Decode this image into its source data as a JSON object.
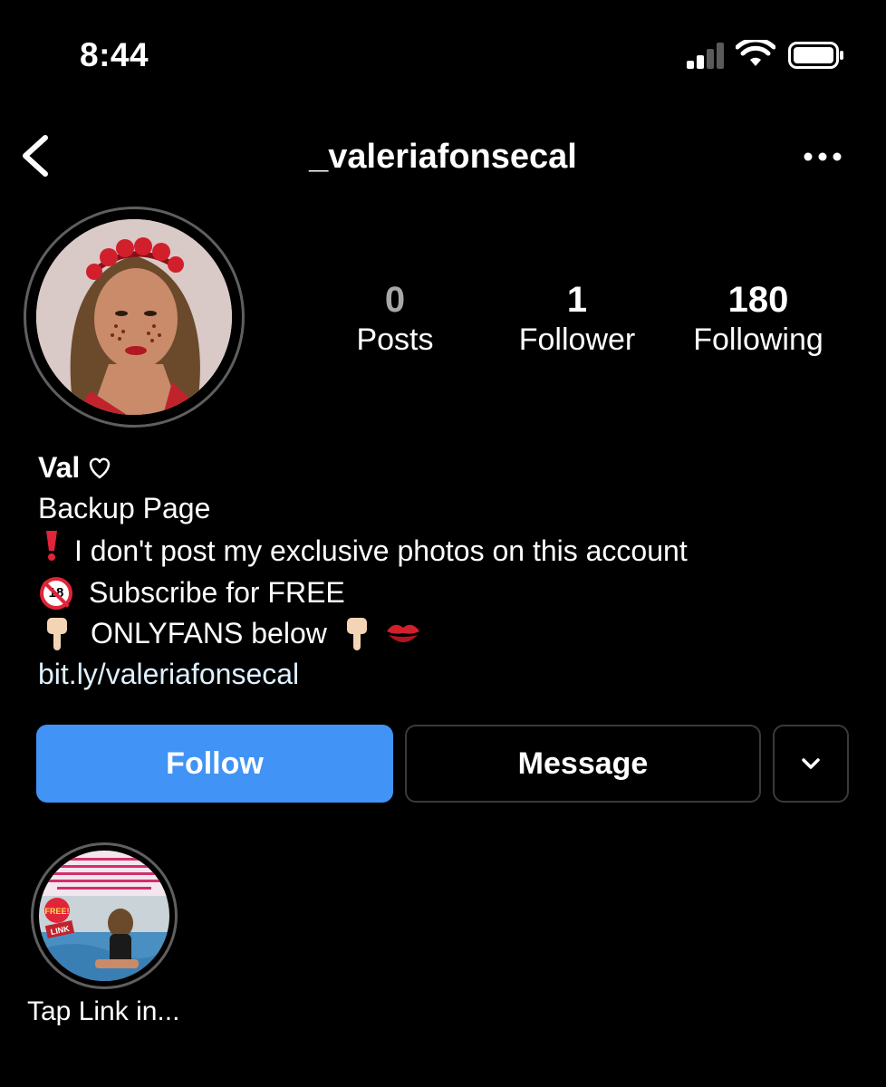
{
  "status_bar": {
    "time": "8:44",
    "icons": [
      "cellular-signal-icon",
      "wifi-icon",
      "battery-icon"
    ]
  },
  "header": {
    "username": "_valeriafonsecal",
    "back_icon": "chevron-left-icon",
    "more_icon": "more-dots-icon"
  },
  "stats": {
    "posts": {
      "count": "0",
      "label": "Posts"
    },
    "followers": {
      "count": "1",
      "label": "Follower"
    },
    "following": {
      "count": "180",
      "label": "Following"
    }
  },
  "bio": {
    "name": "Val",
    "name_icon": "heart-outline-icon",
    "lines": [
      "Backup Page",
      "I don't post my exclusive photos on this account",
      "Subscribe for FREE",
      "ONLYFANS below"
    ],
    "emojis": [
      "heavy-exclamation-icon",
      "no-under-18-icon",
      "pointing-down-icon",
      "pointing-down-icon",
      "kiss-mark-icon"
    ],
    "link": "bit.ly/valeriafonsecal"
  },
  "actions": {
    "follow": "Follow",
    "message": "Message",
    "more_icon": "chevron-down-icon"
  },
  "highlights": [
    {
      "label": "Tap Link in...",
      "badge": "FREE!",
      "badge2": "LINK"
    }
  ],
  "colors": {
    "background": "#000000",
    "follow_button": "#4193f5",
    "link_text": "#e0f1ff",
    "border": "#3a3a3a"
  }
}
